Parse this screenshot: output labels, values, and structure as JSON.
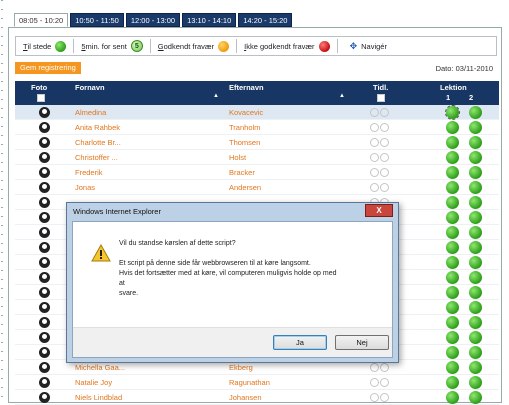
{
  "tabs": [
    "08:05 - 10:20",
    "10:50 - 11:50",
    "12:00 - 13:00",
    "13:10 - 14:10",
    "14:20 - 15:20"
  ],
  "legend": {
    "til_stede_u": "T",
    "til_stede_rest": "il stede",
    "min_sent_u": "5",
    "min_sent_rest": " min. for sent",
    "min_sent_badge": "5",
    "godkendt_u": "G",
    "godkendt_rest": "odkendt fravær",
    "ikke_u": "I",
    "ikke_rest": "kke godkendt fravær",
    "naviger": "Navigér"
  },
  "save_label": "Gem registrering",
  "date_text": "Dato: 03/11-2010",
  "columns": {
    "foto": "Foto",
    "fornavn": "Fornavn",
    "efternavn": "Efternavn",
    "tidl": "Tidl.",
    "lektion": "Lektion",
    "l1": "1",
    "l2": "2"
  },
  "students": [
    {
      "first": "Almedina",
      "last": "Kovacevic"
    },
    {
      "first": "Anita Rahbek",
      "last": "Tranholm"
    },
    {
      "first": "Charlotte Br...",
      "last": "Thomsen"
    },
    {
      "first": "Christoffer ...",
      "last": "Holst"
    },
    {
      "first": "Frederik",
      "last": "Bracker"
    },
    {
      "first": "Jonas",
      "last": "Andersen"
    },
    {
      "first": "",
      "last": ""
    },
    {
      "first": "",
      "last": ""
    },
    {
      "first": "",
      "last": ""
    },
    {
      "first": "",
      "last": ""
    },
    {
      "first": "",
      "last": ""
    },
    {
      "first": "",
      "last": ""
    },
    {
      "first": "",
      "last": ""
    },
    {
      "first": "",
      "last": ""
    },
    {
      "first": "",
      "last": ""
    },
    {
      "first": "",
      "last": ""
    },
    {
      "first": "",
      "last": ""
    },
    {
      "first": "Michella Gaa...",
      "last": "Ekberg"
    },
    {
      "first": "Natalie Joy",
      "last": "Ragunathan"
    },
    {
      "first": "Niels Lindblad",
      "last": "Johansen"
    }
  ],
  "dialog": {
    "title": "Windows Internet Explorer",
    "close": "X",
    "question": "Vil du standse kørslen af dette script?",
    "line1": "Et script på denne side får webbrowseren til at køre langsomt.",
    "line2": "Hvis det fortsætter med at køre, vil computeren muligvis holde op med",
    "line3": "at",
    "line4": "svare.",
    "yes": "Ja",
    "no": "Nej"
  },
  "colors": {
    "accent": "#173663",
    "link": "#e1761e",
    "save": "#f49620",
    "present": "#2e9d1a"
  }
}
